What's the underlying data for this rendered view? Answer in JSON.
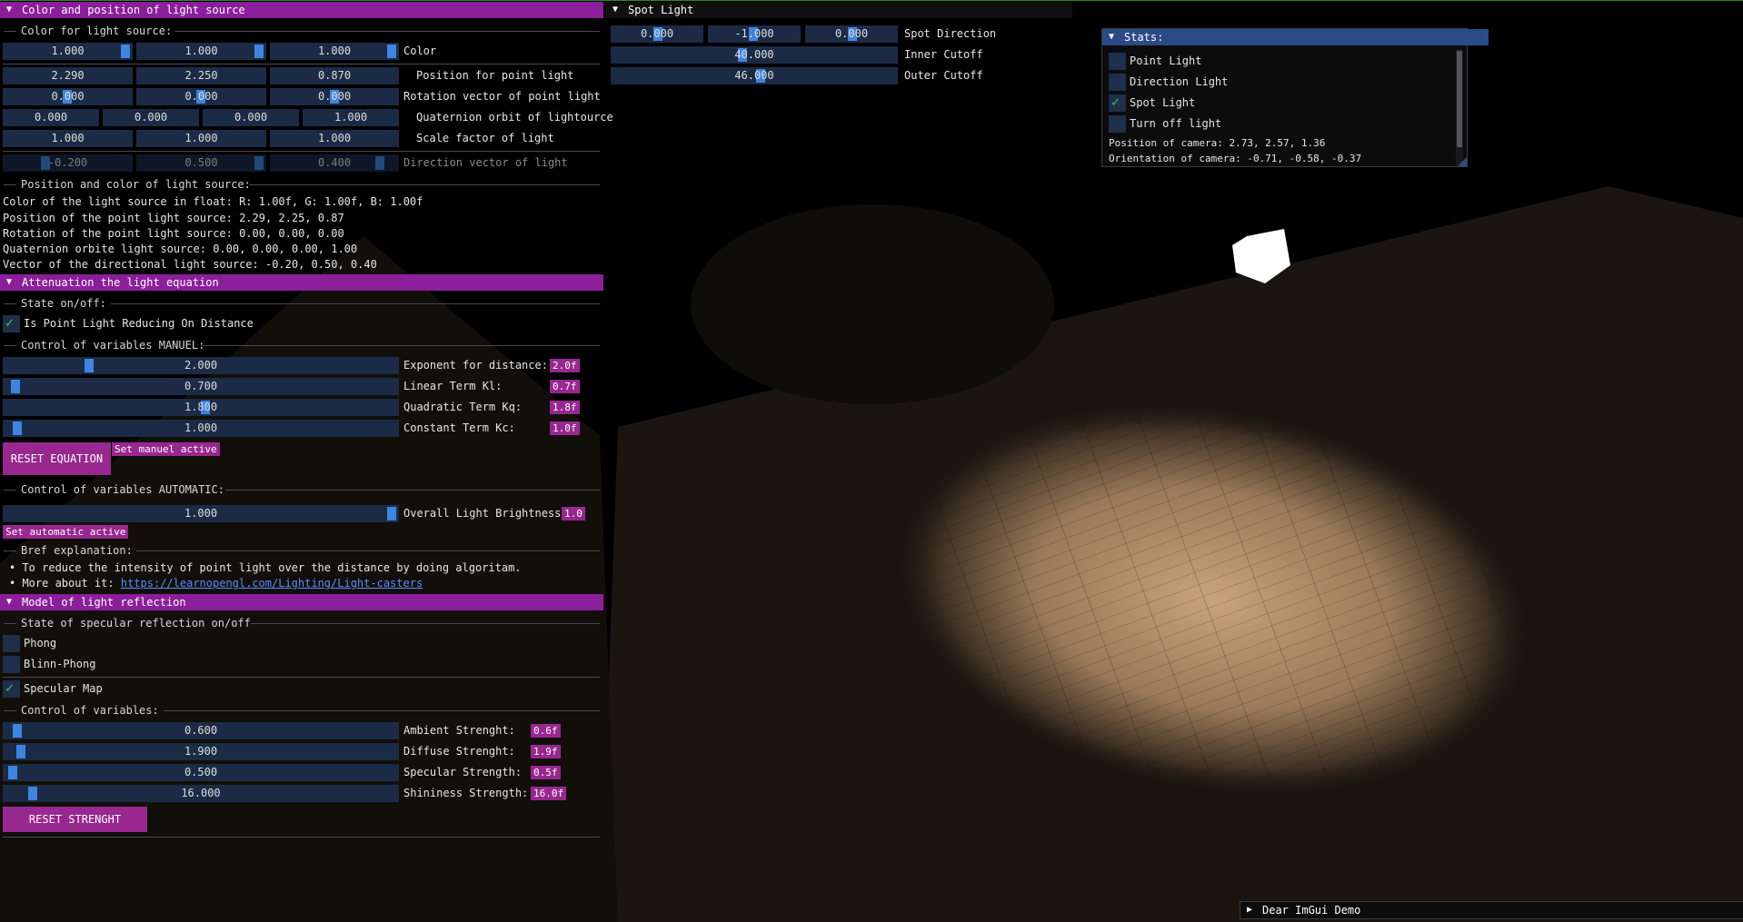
{
  "light_panel": {
    "title": "Color and position of light source",
    "section_color": "Color for light source:",
    "color_values": [
      "1.000",
      "1.000",
      "1.000"
    ],
    "color_label": "Color",
    "position_values": [
      "2.290",
      "2.250",
      "0.870"
    ],
    "position_label": "Position for point light",
    "rotation_values": [
      "0.000",
      "0.000",
      "0.000"
    ],
    "rotation_label": "Rotation vector of point light",
    "quaternion_values": [
      "0.000",
      "0.000",
      "0.000",
      "1.000"
    ],
    "quaternion_label": "Quaternion orbit of lightource",
    "scale_values": [
      "1.000",
      "1.000",
      "1.000"
    ],
    "scale_label": "Scale factor of light",
    "direction_values": [
      "-0.200",
      "0.500",
      "0.400"
    ],
    "direction_label": "Direction vector of light",
    "section_info": "Position and color of light source:",
    "info_lines": [
      "Color of the light source in float: R: 1.00f, G: 1.00f, B: 1.00f",
      "Position of the point light source: 2.29, 2.25, 0.87",
      "Rotation of the point light source: 0.00, 0.00, 0.00",
      "Quaternion orbite light source: 0.00, 0.00, 0.00, 1.00",
      "Vector of the directional light source: -0.20, 0.50, 0.40"
    ]
  },
  "attenuation_panel": {
    "title": "Attenuation the light equation",
    "section_state": "State on/off:",
    "checkbox_label": "Is Point Light Reducing On Distance",
    "checkbox_checked": true,
    "section_manual": "Control of variables MANUEL:",
    "manual_sliders": [
      {
        "value": "2.000",
        "label": "Exponent for distance:",
        "badge": "2.0f"
      },
      {
        "value": "0.700",
        "label": "Linear Term Kl:",
        "badge": "0.7f"
      },
      {
        "value": "1.800",
        "label": "Quadratic Term Kq:",
        "badge": "1.8f"
      },
      {
        "value": "1.000",
        "label": "Constant Term Kc:",
        "badge": "1.0f"
      }
    ],
    "reset_button": "RESET EQUATION",
    "manual_active": "Set manuel active",
    "section_auto": "Control of variables AUTOMATIC:",
    "brightness_value": "1.000",
    "brightness_label": "Overall Light Brightness:",
    "brightness_badge": "1.0",
    "auto_active": "Set automatic active",
    "section_explain": "Bref explanation:",
    "bullet_1": "To reduce the intensity of point light over the distance by doing algoritam.",
    "bullet_2_prefix": "More about it:",
    "bullet_2_link": "https://learnopengl.com/Lighting/Light-casters"
  },
  "reflection_panel": {
    "title": "Model of light reflection",
    "section_state": "State of specular reflection on/off",
    "phong_label": "Phong",
    "blinn_label": "Blinn-Phong",
    "specular_map_label": "Specular Map",
    "section_vars": "Control of variables:",
    "sliders": [
      {
        "value": "0.600",
        "label": "Ambient Strenght:",
        "badge": "0.6f"
      },
      {
        "value": "1.900",
        "label": "Diffuse Strenght:",
        "badge": "1.9f"
      },
      {
        "value": "0.500",
        "label": "Specular Strength:",
        "badge": "0.5f"
      },
      {
        "value": "16.000",
        "label": "Shininess Strength:",
        "badge": "16.0f"
      }
    ],
    "reset_button": "RESET STRENGHT"
  },
  "spot_panel": {
    "title": "Spot Light",
    "direction_values": [
      "0.000",
      "-1.000",
      "0.000"
    ],
    "direction_label": "Spot Direction",
    "inner_value": "40.000",
    "inner_label": "Inner Cutoff",
    "outer_value": "46.000",
    "outer_label": "Outer Cutoff"
  },
  "stats_panel": {
    "title": "Stats:",
    "options": [
      {
        "label": "Point Light",
        "checked": false
      },
      {
        "label": "Direction Light",
        "checked": false
      },
      {
        "label": "Spot Light",
        "checked": true
      },
      {
        "label": "Turn off light",
        "checked": false
      }
    ],
    "camera_position": "Position of camera: 2.73, 2.57, 1.36",
    "camera_orientation": "Orientation of camera: -0.71, -0.58, -0.37"
  },
  "demo_window": {
    "title": "Dear ImGui Demo"
  },
  "colors": {
    "header_purple": "#8b1e9b",
    "badge_purple": "#98278f",
    "slider_bg": "#1c2b45",
    "grab_blue": "#3d85e0",
    "check_green": "#39c15a"
  }
}
